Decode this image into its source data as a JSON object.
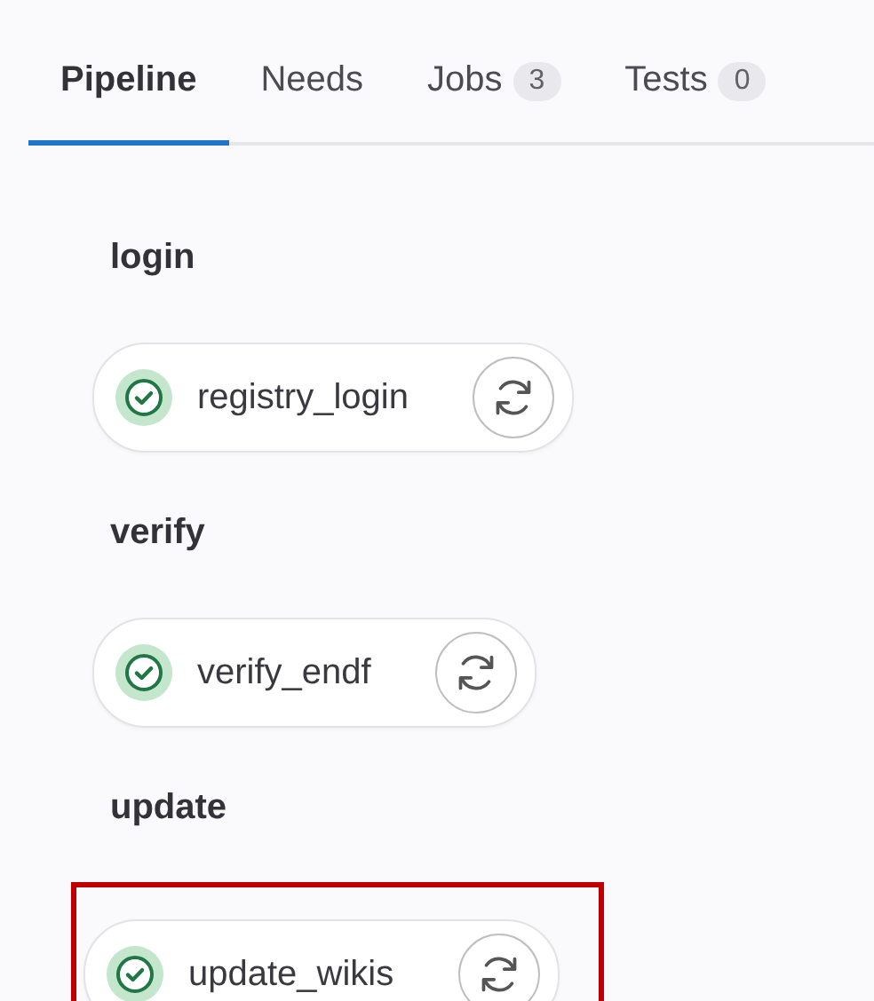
{
  "tabs": [
    {
      "label": "Pipeline",
      "selected": true
    },
    {
      "label": "Needs",
      "selected": false
    },
    {
      "label": "Jobs",
      "count": "3",
      "selected": false
    },
    {
      "label": "Tests",
      "count": "0",
      "selected": false
    }
  ],
  "stages": [
    {
      "title": "login",
      "highlighted": false,
      "jobs": [
        {
          "name": "registry_login",
          "passed": true
        }
      ]
    },
    {
      "title": "verify",
      "highlighted": false,
      "jobs": [
        {
          "name": "verify_endf",
          "passed": true
        }
      ]
    },
    {
      "title": "update",
      "highlighted": true,
      "jobs": [
        {
          "name": "update_wikis",
          "passed": true
        }
      ]
    }
  ]
}
